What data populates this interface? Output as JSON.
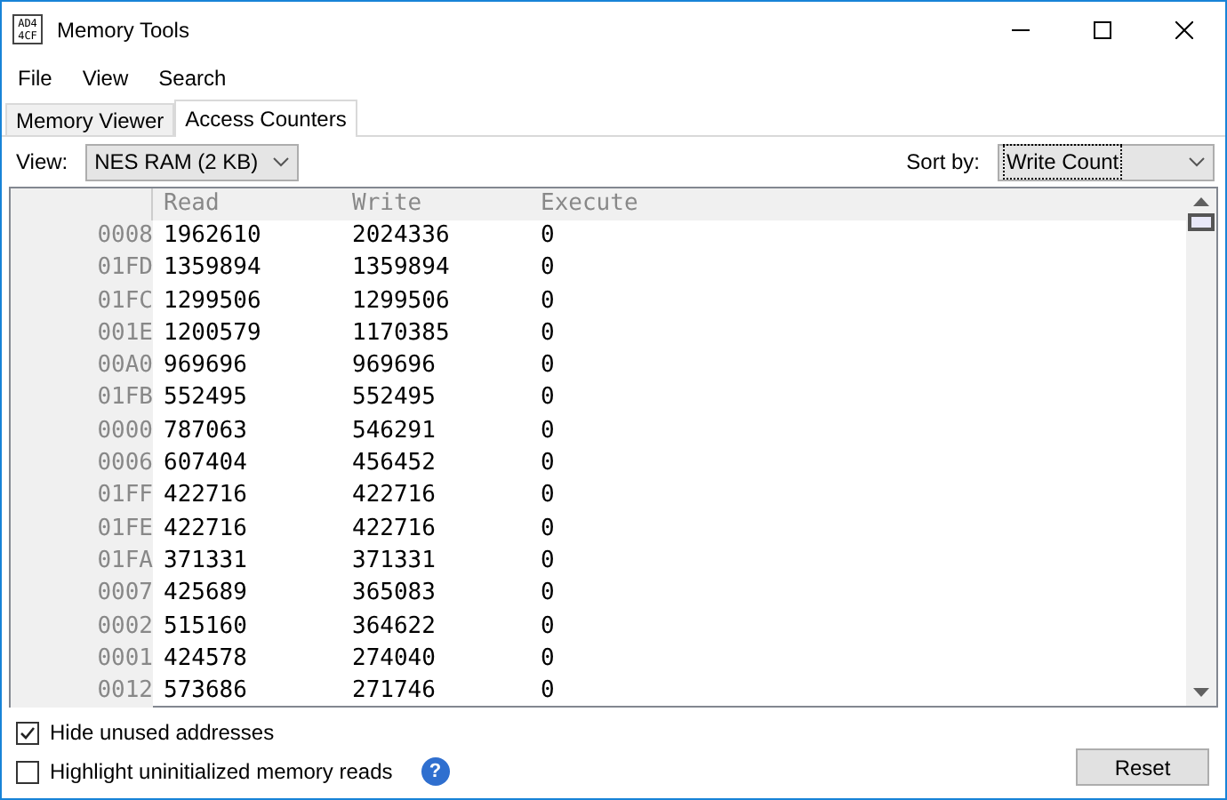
{
  "window": {
    "title": "Memory Tools",
    "icon_text": [
      "AD4",
      "4CF"
    ]
  },
  "menu": [
    "File",
    "View",
    "Search"
  ],
  "tabs": [
    {
      "label": "Memory Viewer",
      "selected": false
    },
    {
      "label": "Access Counters",
      "selected": true
    }
  ],
  "view": {
    "label": "View:",
    "value": "NES RAM (2 KB)"
  },
  "sort": {
    "label": "Sort by:",
    "value": "Write Count"
  },
  "table": {
    "columns": [
      "",
      "Read",
      "Write",
      "Execute"
    ],
    "rows": [
      [
        "0008",
        "1962610",
        "2024336",
        "0"
      ],
      [
        "01FD",
        "1359894",
        "1359894",
        "0"
      ],
      [
        "01FC",
        "1299506",
        "1299506",
        "0"
      ],
      [
        "001E",
        "1200579",
        "1170385",
        "0"
      ],
      [
        "00A0",
        "969696",
        "969696",
        "0"
      ],
      [
        "01FB",
        "552495",
        "552495",
        "0"
      ],
      [
        "0000",
        "787063",
        "546291",
        "0"
      ],
      [
        "0006",
        "607404",
        "456452",
        "0"
      ],
      [
        "01FF",
        "422716",
        "422716",
        "0"
      ],
      [
        "01FE",
        "422716",
        "422716",
        "0"
      ],
      [
        "01FA",
        "371331",
        "371331",
        "0"
      ],
      [
        "0007",
        "425689",
        "365083",
        "0"
      ],
      [
        "0002",
        "515160",
        "364622",
        "0"
      ],
      [
        "0001",
        "424578",
        "274040",
        "0"
      ],
      [
        "0012",
        "573686",
        "271746",
        "0"
      ]
    ]
  },
  "options": [
    {
      "label": "Hide unused addresses",
      "checked": true
    },
    {
      "label": "Highlight uninitialized memory reads",
      "checked": false
    }
  ],
  "help_icon": "?",
  "reset_button": "Reset"
}
